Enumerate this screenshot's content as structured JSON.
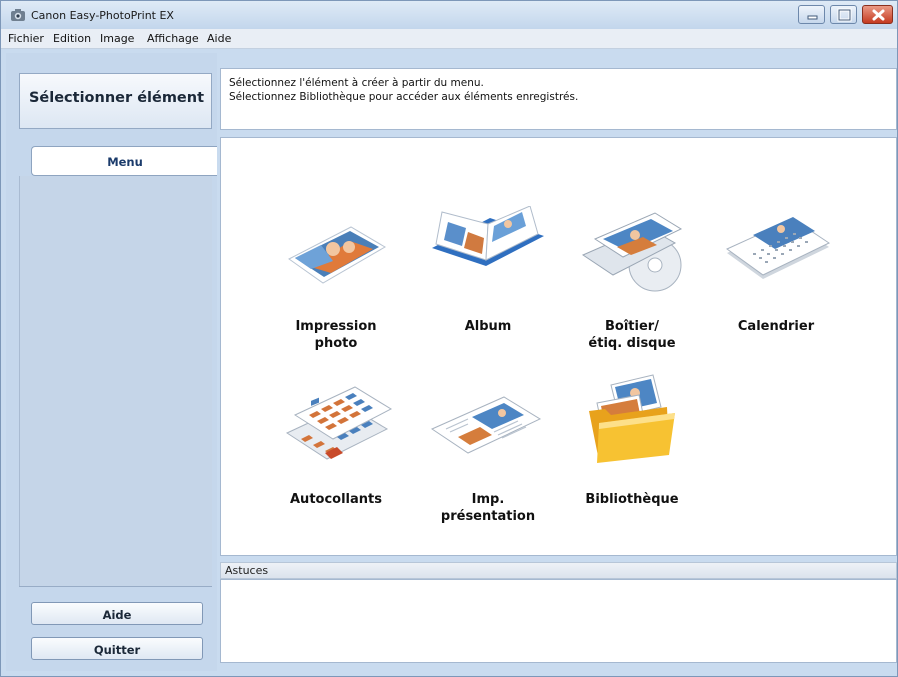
{
  "window": {
    "title": "Canon Easy-PhotoPrint EX"
  },
  "menubar": {
    "items": [
      {
        "label": "Fichier"
      },
      {
        "label": "Edition"
      },
      {
        "label": "Image"
      },
      {
        "label": "Affichage"
      },
      {
        "label": "Aide"
      }
    ]
  },
  "sidebar": {
    "header": "Sélectionner élément",
    "menu_tab": "Menu",
    "help_button": "Aide",
    "quit_button": "Quitter"
  },
  "instructions": {
    "line1": "Sélectionnez l'élément à créer à partir du menu.",
    "line2": "Sélectionnez Bibliothèque pour accéder aux éléments enregistrés."
  },
  "items": [
    {
      "label_line1": "Impression",
      "label_line2": "photo",
      "icon": "photo-print-icon"
    },
    {
      "label_line1": "Album",
      "label_line2": "",
      "icon": "album-icon"
    },
    {
      "label_line1": "Boîtier/",
      "label_line2": "étiq. disque",
      "icon": "disc-label-icon"
    },
    {
      "label_line1": "Calendrier",
      "label_line2": "",
      "icon": "calendar-icon"
    },
    {
      "label_line1": "Autocollants",
      "label_line2": "",
      "icon": "stickers-icon"
    },
    {
      "label_line1": "Imp.",
      "label_line2": "présentation",
      "icon": "layout-print-icon"
    },
    {
      "label_line1": "Bibliothèque",
      "label_line2": "",
      "icon": "library-folder-icon"
    }
  ],
  "tips": {
    "header": "Astuces"
  }
}
